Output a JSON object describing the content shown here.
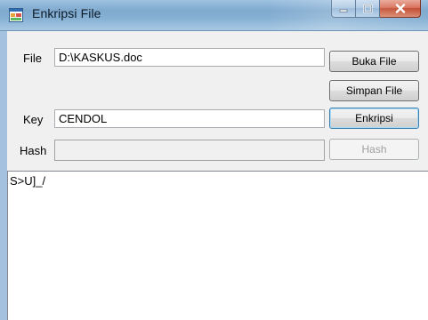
{
  "window": {
    "title": "Enkripsi File",
    "icons": {
      "app": "windows-form-icon",
      "minimize": "minimize-icon",
      "maximize": "maximize-icon",
      "close": "close-icon"
    }
  },
  "form": {
    "file_label": "File",
    "file_value": "D:\\KASKUS.doc",
    "key_label": "Key",
    "key_value": "CENDOL",
    "hash_label": "Hash",
    "hash_value": ""
  },
  "buttons": {
    "open_file": "Buka File",
    "save_file": "Simpan File",
    "encrypt": "Enkripsi",
    "hash": "Hash"
  },
  "output": {
    "text": "S>U]_/"
  },
  "colors": {
    "titlebar": "#86b0d3",
    "close_button": "#c24a30",
    "client_bg": "#f0f0f0"
  }
}
